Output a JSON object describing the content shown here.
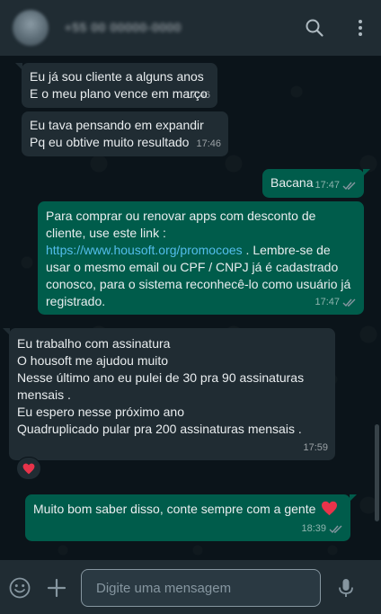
{
  "header": {
    "contact_name": "+55 00 00000-0000"
  },
  "messages": [
    {
      "direction": "in",
      "lines": [
        "Eu já sou cliente a alguns anos",
        "E o meu plano vence em março"
      ],
      "time": "17:46"
    },
    {
      "direction": "in",
      "lines": [
        "Eu tava pensando em expandir",
        "Pq eu obtive muito resultado"
      ],
      "time": "17:46"
    },
    {
      "direction": "out",
      "lines": [
        "Bacana"
      ],
      "time": "17:47"
    },
    {
      "direction": "out",
      "line1": "Para comprar ou renovar apps com desconto de",
      "line2": "cliente, use este link :",
      "link": "https://www.housoft.org/promocoes",
      "line3_rest": " . Lembre-se de",
      "line4": "usar o mesmo email ou CPF / CNPJ já é cadastrado",
      "line5": "conosco, para o sistema reconhecê-lo como usuário já",
      "line6": "registrado.",
      "time": "17:47"
    },
    {
      "direction": "in",
      "lines": [
        "Eu trabalho com assinatura",
        "O housoft me ajudou muito",
        "Nesse último ano eu pulei de 30 pra 90 assinaturas",
        "mensais .",
        "Eu espero nesse próximo ano",
        "Quadruplicado pular pra 200 assinaturas mensais ."
      ],
      "time": "17:59",
      "reaction": "heart"
    },
    {
      "direction": "out",
      "lines": [
        "Muito bom saber disso, conte sempre com a gente"
      ],
      "emoji": "heart",
      "time": "18:39"
    }
  ],
  "composer": {
    "placeholder": "Digite uma mensagem"
  },
  "icons": {
    "header": [
      "search-icon",
      "menu-icon"
    ],
    "footer": [
      "emoji-icon",
      "attach-icon",
      "mic-icon"
    ]
  },
  "colors": {
    "background": "#0b141a",
    "bar": "#202c33",
    "incoming": "#202c33",
    "outgoing": "#005c4b",
    "link": "#53bdeb",
    "read_ticks": "#8696a0"
  }
}
